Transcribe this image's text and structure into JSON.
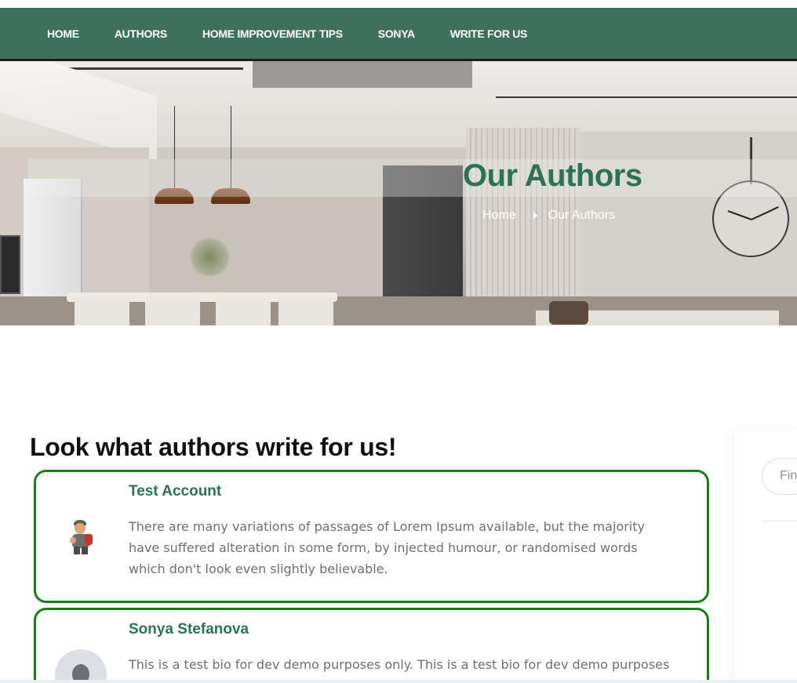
{
  "nav": {
    "items": [
      "HOME",
      "AUTHORS",
      "HOME IMPROVEMENT TIPS",
      "SONYA",
      "WRITE FOR US"
    ]
  },
  "hero": {
    "title": "Our Authors",
    "breadcrumb": {
      "home": "Home",
      "current": "Our Authors"
    }
  },
  "main": {
    "heading": "Look what authors write for us!",
    "authors": [
      {
        "name": "Test Account",
        "bio": "There are many variations of passages of Lorem Ipsum available, but the majority have suffered alteration in some form, by injected humour, or randomised words which don't look even slightly believable.",
        "avatar": "worker-avatar-icon"
      },
      {
        "name": "Sonya Stefanova",
        "bio": "This is a test bio for dev demo purposes only. This is a test bio for dev demo purposes only.",
        "avatar": "default-user-avatar-icon"
      }
    ]
  },
  "sidebar": {
    "search_placeholder": "Find"
  },
  "colors": {
    "nav_bg": "#3e705e",
    "accent_green": "#2b7256",
    "card_border": "#128112"
  }
}
